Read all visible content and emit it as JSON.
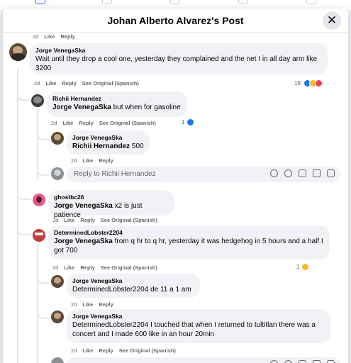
{
  "modal": {
    "title": "Johan Alberto Alvarez's Post"
  },
  "top_actions": {
    "time": "2d",
    "like": "Like",
    "reply": "Reply"
  },
  "comments": [
    {
      "author": "Jorge VenegaSka",
      "text": "Wait until they drop a cool one, yesterday they complained and the net I in all day arm like 3200",
      "time": "2d",
      "like": "Like",
      "reply": "Reply",
      "see_original": "See Original (Spanish)",
      "reaction_count": "18"
    },
    {
      "author": "Richii Hernandez",
      "mention": "Jorge VenegaSka",
      "text": " but when for gasoline",
      "time": "2d",
      "like": "Like",
      "reply": "Reply",
      "see_original": "See Original (Spanish)",
      "reaction_count": "1"
    },
    {
      "author": "Jorge VenegaSka",
      "mention": "Richii Hernandez",
      "text": " 500",
      "time": "2d",
      "like": "Like",
      "reply": "Reply"
    },
    {
      "author": "ghostbc26",
      "mention": "Jorge VenegaSka",
      "text": " x2 is just patience",
      "time": "2d",
      "like": "Like",
      "reply": "Reply",
      "see_original": "See Original (Spanish)"
    },
    {
      "author": "DeterminedLobster2204",
      "mention": "Jorge VenegaSka",
      "text": " from q hr to q hr, yesterday it was hedgehog in 5 hours and a half I got 700",
      "time": "2d",
      "like": "Like",
      "reply": "Reply",
      "see_original": "See Original (Spanish)",
      "reaction_count": "1"
    },
    {
      "author": "Jorge VenegaSka",
      "text": "DeterminedLobster2204 de 11 a 1 am",
      "time": "2d",
      "like": "Like",
      "reply": "Reply"
    },
    {
      "author": "Jorge VenegaSka",
      "text": "DeterminedLobster2204 I touched that when I returned to tultitlan there was a concert and I made 600 like in an hour 20min",
      "time": "2d",
      "like": "Like",
      "reply": "Reply",
      "see_original": "See Original (Spanish)"
    }
  ],
  "reply_box": {
    "placeholder": "Reply to Richii Hernandez"
  },
  "colors": {
    "like_blue": "#1877f2",
    "haha_yellow": "#f7b928",
    "love_red": "#f33e58"
  }
}
